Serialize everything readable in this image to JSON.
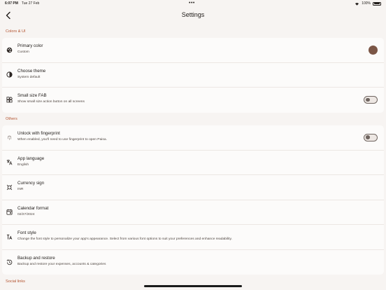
{
  "status": {
    "time": "6:07 PM",
    "date": "Tue 27 Feb",
    "battery": "100%"
  },
  "header": {
    "title": "Settings"
  },
  "sections": {
    "colors": {
      "label": "Colors & UI",
      "primary_color": {
        "title": "Primary color",
        "subtitle": "Custom",
        "swatch": "#7b5646"
      },
      "theme": {
        "title": "Choose theme",
        "subtitle": "System default"
      },
      "fab": {
        "title": "Small size FAB",
        "subtitle": "Show small size action button on all screens",
        "enabled": false
      }
    },
    "others": {
      "label": "Others",
      "fingerprint": {
        "title": "Unlock with fingerprint",
        "subtitle": "When enabled, you'll need to use fingerprint to open Paisa.",
        "enabled": false
      },
      "language": {
        "title": "App language",
        "subtitle": "English"
      },
      "currency": {
        "title": "Currency sign",
        "subtitle": "INR"
      },
      "calendar": {
        "title": "Calendar format",
        "subtitle": "02/27/2024"
      },
      "font": {
        "title": "Font style",
        "subtitle": "Change the font style to personalize your app's appearance. Select from various font options to suit your preferences and enhance readability."
      },
      "backup": {
        "title": "Backup and restore",
        "subtitle": "Backup and restore your expenses, accounts & categories"
      }
    },
    "social": {
      "label": "Social links"
    }
  },
  "colors": {
    "accent": "#b3532f",
    "background": "#f7f4f2"
  }
}
